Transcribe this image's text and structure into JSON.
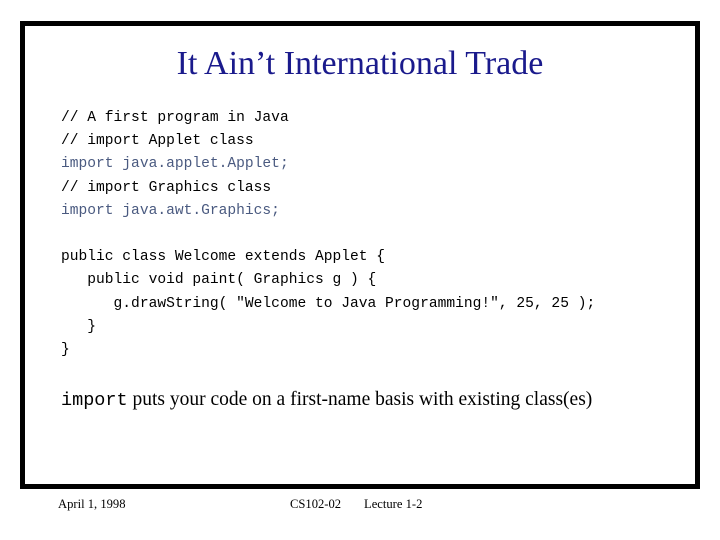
{
  "slide": {
    "title": "It Ain’t International Trade",
    "title_color": "#1a1a8c",
    "border_color": "#000000",
    "background_color": "#ffffff"
  },
  "code": {
    "font": "monospace",
    "comment_color": "#000000",
    "import_color": "#4a5a80",
    "plain_color": "#000000",
    "lines": [
      {
        "kind": "comment",
        "text": "// A first program in Java"
      },
      {
        "kind": "comment",
        "text": "// import Applet class"
      },
      {
        "kind": "import",
        "text": "import java.applet.Applet;"
      },
      {
        "kind": "comment",
        "text": "// import Graphics class"
      },
      {
        "kind": "import",
        "text": "import java.awt.Graphics;"
      },
      {
        "kind": "blank",
        "text": ""
      },
      {
        "kind": "plain",
        "text": "public class Welcome extends Applet {"
      },
      {
        "kind": "plain",
        "text": "   public void paint( Graphics g ) {"
      },
      {
        "kind": "plain",
        "text": "      g.drawString( \"Welcome to Java Programming!\", 25, 25 );"
      },
      {
        "kind": "plain",
        "text": "   }"
      },
      {
        "kind": "plain",
        "text": "}"
      }
    ]
  },
  "paragraph": {
    "keyword": "import",
    "text": " puts your code on a first-name basis with existing class(es)"
  },
  "footer": {
    "date": "April 1, 1998",
    "course": "CS102-02",
    "lecture": "Lecture 1-2"
  }
}
